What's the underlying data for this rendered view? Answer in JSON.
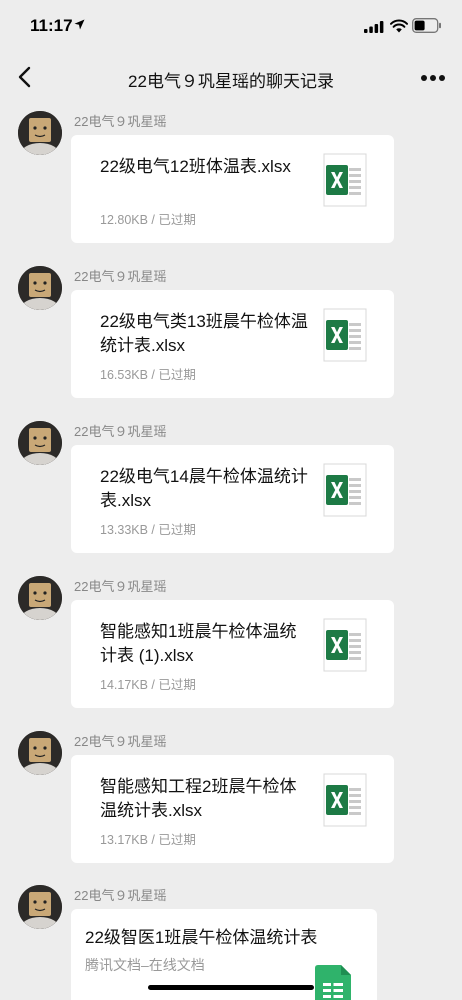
{
  "status": {
    "time": "11:17"
  },
  "nav": {
    "title": "22电气９巩星瑶的聊天记录"
  },
  "messages": [
    {
      "sender": "22电气９巩星瑶",
      "title": "22级电气12班体温表.xlsx",
      "meta": "12.80KB / 已过期"
    },
    {
      "sender": "22电气９巩星瑶",
      "title": "22级电气类13班晨午检体温统计表.xlsx",
      "meta": "16.53KB / 已过期"
    },
    {
      "sender": "22电气９巩星瑶",
      "title": "22级电气14晨午检体温统计表.xlsx",
      "meta": "13.33KB / 已过期"
    },
    {
      "sender": "22电气９巩星瑶",
      "title": "智能感知1班晨午检体温统计表 (1).xlsx",
      "meta": "14.17KB / 已过期"
    },
    {
      "sender": "22电气９巩星瑶",
      "title": "智能感知工程2班晨午检体温统计表.xlsx",
      "meta": "13.17KB / 已过期"
    }
  ],
  "doc_message": {
    "sender": "22电气９巩星瑶",
    "title": "22级智医1班晨午检体温统计表",
    "subtitle": "腾讯文档–在线文档"
  },
  "icons": {
    "excel": "excel-file-icon",
    "sheet": "tencent-sheet-icon",
    "back": "chevron-left-icon",
    "more": "more-dots-icon"
  },
  "colors": {
    "excel_green": "#1d7a45",
    "sheet_green": "#2fb36b",
    "background": "#ededed"
  }
}
